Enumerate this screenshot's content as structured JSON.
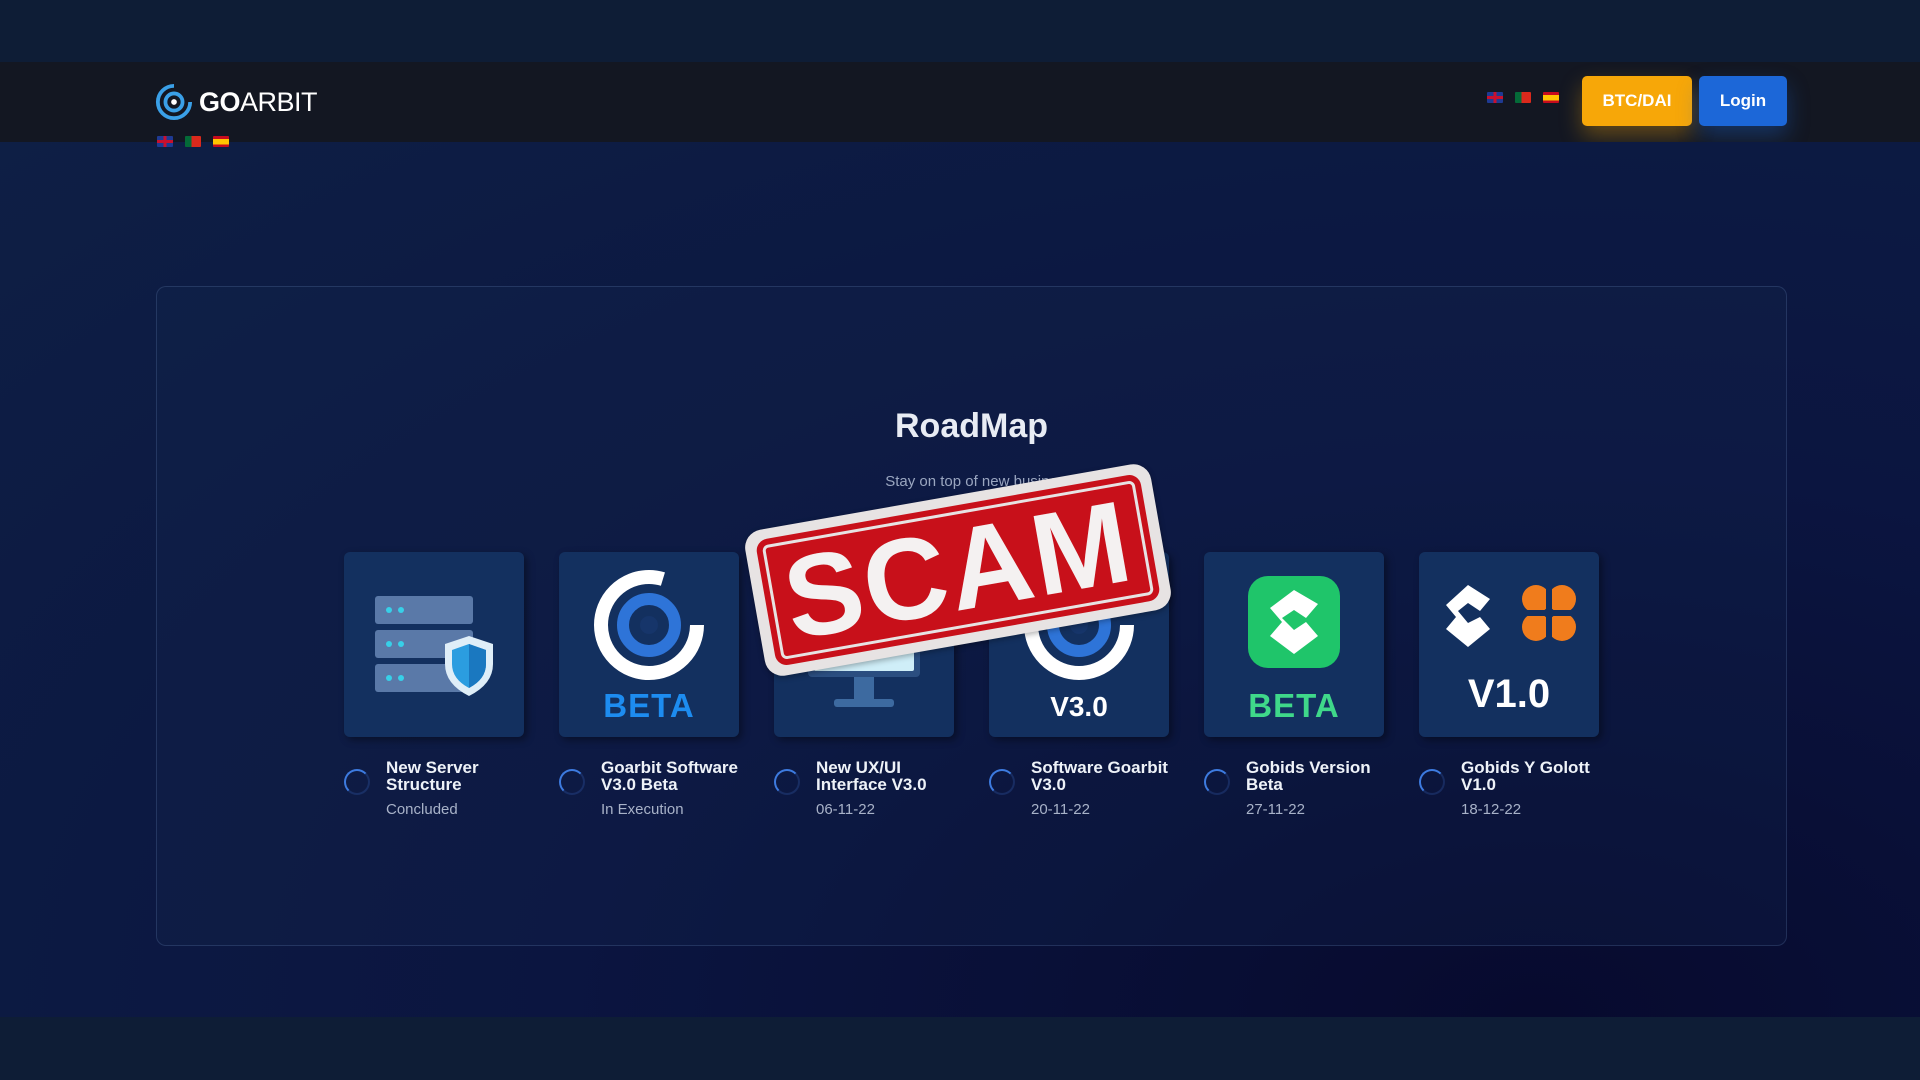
{
  "header": {
    "logo_bold": "GO",
    "logo_light": "ARBIT",
    "btc_label": "BTC/DAI",
    "login_label": "Login",
    "languages": [
      "uk-flag-icon",
      "portugal-flag-icon",
      "spain-flag-icon"
    ]
  },
  "roadmap": {
    "title": "RoadMap",
    "subtitle": "Stay on top of new busine",
    "items": [
      {
        "title": "New Server Structure",
        "status": "Concluded",
        "icon": "server-shield-icon"
      },
      {
        "title": "Goarbit Software V3.0 Beta",
        "status": "In Execution",
        "icon": "goarbit-beta-icon",
        "image_label": "BETA"
      },
      {
        "title": "New UX/UI Interface V3.0",
        "status": "06-11-22",
        "icon": "monitor-icon"
      },
      {
        "title": "Software Goarbit V3.0",
        "status": "20-11-22",
        "icon": "goarbit-v3-icon",
        "image_label": "V3.0"
      },
      {
        "title": "Gobids Version Beta",
        "status": "27-11-22",
        "icon": "gobids-beta-icon",
        "image_label": "BETA"
      },
      {
        "title": "Gobids Y Golott V1.0",
        "status": "18-12-22",
        "icon": "gobids-golott-icon",
        "image_label": "V1.0"
      }
    ]
  },
  "stamp": {
    "text": "SCAM"
  },
  "colors": {
    "accent_orange": "#f7a708",
    "accent_blue": "#1c67d8",
    "stamp_red": "#c8101a",
    "gobids_green": "#1fc56a"
  }
}
